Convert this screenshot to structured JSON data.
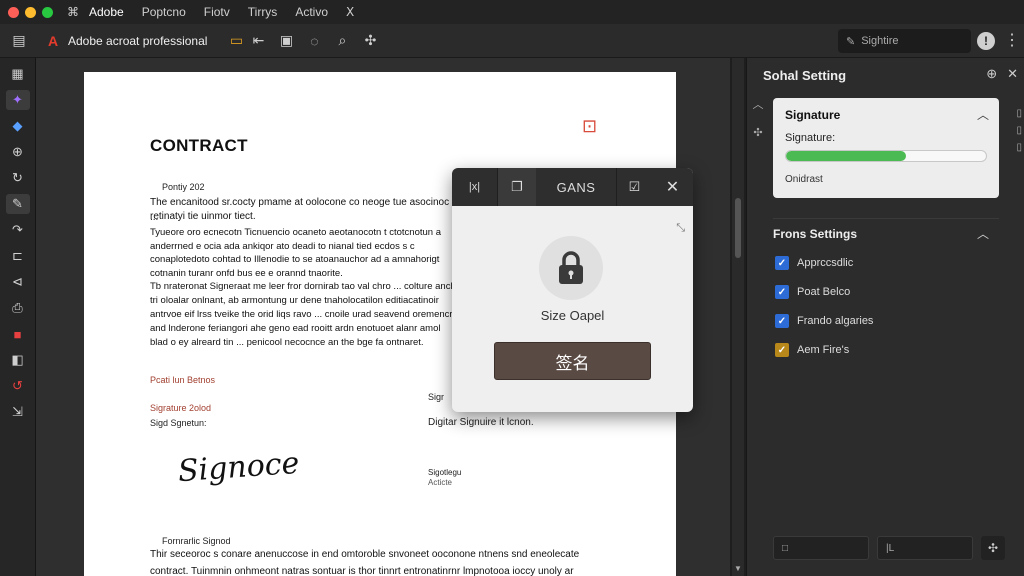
{
  "menubar": {
    "app": "Adobe",
    "items": [
      "Poptcno",
      "Fiotv",
      "Tirrys",
      "Activo",
      "Ⅹ"
    ]
  },
  "toolbar": {
    "app_name": "Adobe acroat professional",
    "search_label": "Sightire"
  },
  "document": {
    "title": "CONTRACT",
    "date": "Pontiy 202",
    "p1": "The encanitood sr.cocty pmame at oolocone co neoge tue asocinoc ...",
    "p1b": "retinatyi tie uinmor tiect.",
    "p2": "Tyueore oro ecnecotn Ticnuencio ocaneto aeotanocotn t ctotcnotun a anderrned e ocia ada ankiqor ato deadi to nianal tied ecdos s c conaplotedoto cohtad to Illenodie to se atoanauchor ad a amnahorigt cotnanin turanr onfd bus ee e orannd tnaorite.",
    "p3": "Tb nrateronat Signeraat me leer fror dornirab tao val chro ... colture anclia tri oloalar onlnant, ab armontung ur dene tnaholocatilon editiacatinoir antrvoe eif lrss tveike the orid liqs ravo ... cnoile urad seavend oremencr and lnderone feriangori ahe geno ead rooitt ardn enotuoet alanr amol blad o ey alreard tin ... penicool necocnce an the bge fa ontnaret.",
    "section": "Pcati lun Betnos",
    "sig_label_top": "Sigrature 2olod",
    "sig_label": "Sigd Sgnetun:",
    "signature": "Signoce",
    "mid_sig": "Sigr",
    "digital": "Digitar Signuire it lcnon.",
    "sigstage": "Sigotlegu",
    "sigsub": "Acticte",
    "farm": "Fornrarlic Signod",
    "bottom1": "Thir seceoroc s conare anenuccose in end omtoroble snvoneet ooconone ntnens snd eneolecate",
    "bottom2": "contract. Tuinmnin onhmeont natras sontuar is thor tinnrt entronatinrnr lmpnotooa ioccy unoly ar"
  },
  "dialog": {
    "tab_1": "|x|",
    "tab_active": "GANS",
    "label": "Size Oapel",
    "button": "签名"
  },
  "panel": {
    "title": "Sohal Setting",
    "card_title": "Signature",
    "card_label": "Signature:",
    "card_progress": 0.6,
    "card_sub": "Onidrast",
    "fs_title": "Frons Settings",
    "options": [
      {
        "label": "Apprccsdlic",
        "checked": true,
        "color": "#2d6cd6"
      },
      {
        "label": "Poat Belco",
        "checked": true,
        "color": "#2d6cd6"
      },
      {
        "label": "Frando algaries",
        "checked": true,
        "color": "#2d6cd6"
      },
      {
        "label": "Aem Fire's",
        "checked": true,
        "color": "#b8881a"
      }
    ],
    "bottom_field": "|L"
  },
  "colors": {
    "accent_blue": "#2d6cd6",
    "accent_green": "#4cba52",
    "accent_red": "#d84a3a",
    "dialog_button": "#5a4a44"
  }
}
